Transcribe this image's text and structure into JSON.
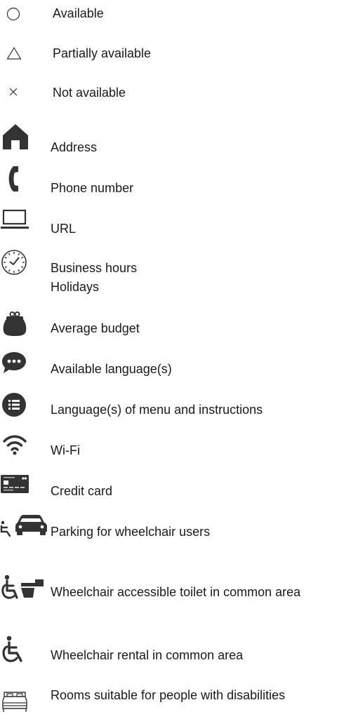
{
  "legend": {
    "available": {
      "label": "Available",
      "icon": "circle-icon"
    },
    "partially_available": {
      "label": "Partially available",
      "icon": "triangle-icon"
    },
    "not_available": {
      "label": "Not available",
      "icon": "cross-icon"
    },
    "address": {
      "label": "Address",
      "icon": "home-icon"
    },
    "phone": {
      "label": "Phone number",
      "icon": "phone-icon"
    },
    "url": {
      "label": "URL",
      "icon": "laptop-icon"
    },
    "business_hours": {
      "label_line1": "Business hours",
      "label_line2": "Holidays",
      "icon": "clock-icon"
    },
    "budget": {
      "label": "Average budget",
      "icon": "purse-icon"
    },
    "languages": {
      "label": "Available language(s)",
      "icon": "speech-bubble-icon"
    },
    "menu_languages": {
      "label": "Language(s) of menu and instructions",
      "icon": "list-icon"
    },
    "wifi": {
      "label": "Wi-Fi",
      "icon": "wifi-icon"
    },
    "credit_card": {
      "label": "Credit card",
      "icon": "credit-card-icon"
    },
    "parking": {
      "label": "Parking for wheelchair users",
      "icon": "wheelchair-car-icon"
    },
    "toilet": {
      "label": "Wheelchair accessible toilet in common area",
      "icon": "wheelchair-toilet-icon"
    },
    "wheelchair_rental": {
      "label": "Wheelchair rental in common area",
      "icon": "wheelchair-icon"
    },
    "accessible_rooms": {
      "label": "Rooms suitable for people with disabilities",
      "icon": "bed-icon"
    }
  },
  "colors": {
    "icon": "#333333",
    "text": "#1a1a1a",
    "background": "#ffffff"
  }
}
